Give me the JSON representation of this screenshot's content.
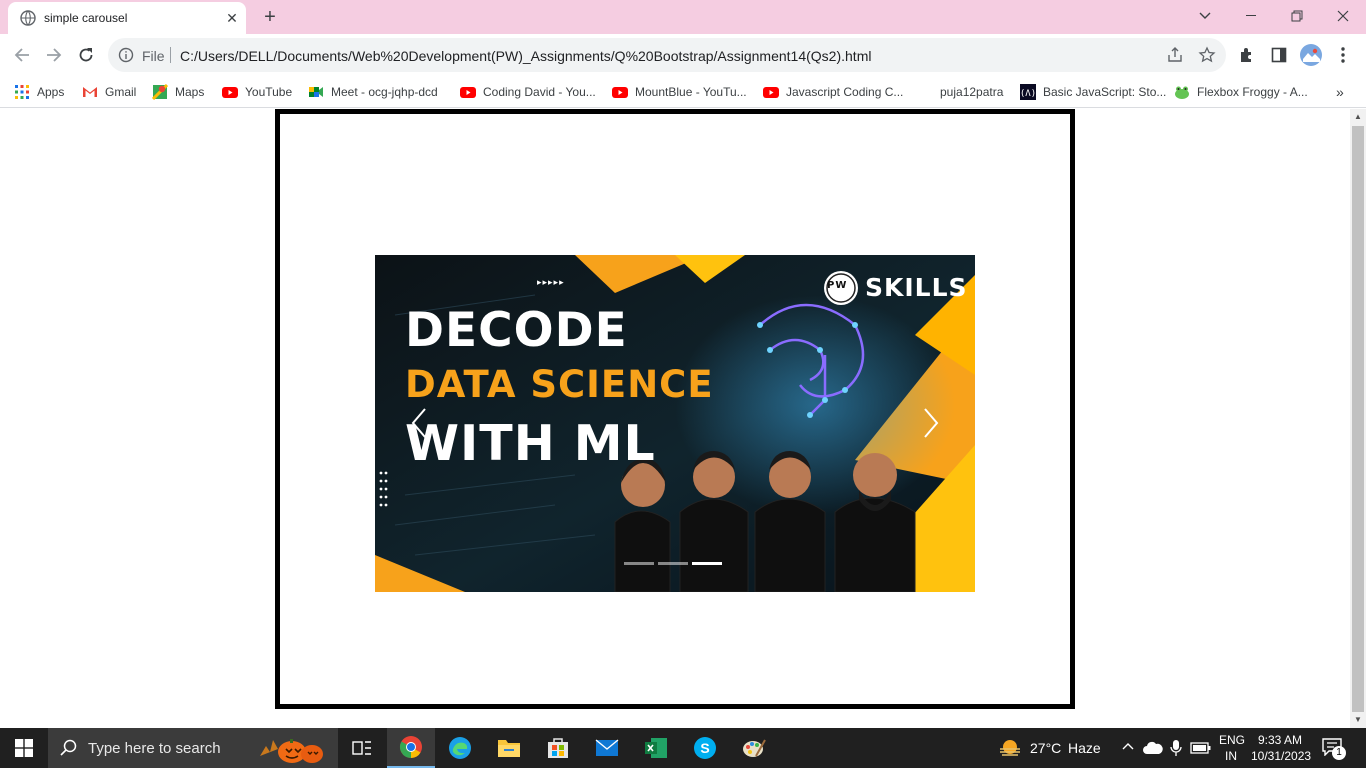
{
  "browser": {
    "tab_title": "simple carousel",
    "tab_close": "✕",
    "new_tab": "+",
    "omnibox": {
      "scheme_label": "File",
      "url": "C:/Users/DELL/Documents/Web%20Development(PW)_Assignments/Q%20Bootstrap/Assignment14(Qs2).html"
    },
    "bookmarks": [
      {
        "label": "Apps",
        "icon": "apps-grid-icon"
      },
      {
        "label": "Gmail",
        "icon": "gmail-icon"
      },
      {
        "label": "Maps",
        "icon": "maps-icon"
      },
      {
        "label": "YouTube",
        "icon": "youtube-icon"
      },
      {
        "label": "Meet - ocg-jqhp-dcd",
        "icon": "meet-icon"
      },
      {
        "label": "Coding David - You...",
        "icon": "youtube-icon"
      },
      {
        "label": "MountBlue - YouTu...",
        "icon": "youtube-icon"
      },
      {
        "label": "Javascript Coding C...",
        "icon": "youtube-icon"
      },
      {
        "label": "puja12patra",
        "icon": "none"
      },
      {
        "label": "Basic JavaScript: Sto...",
        "icon": "freecodecamp-icon"
      },
      {
        "label": "Flexbox Froggy - A...",
        "icon": "frog-icon"
      }
    ],
    "bookmarks_more": "»"
  },
  "carousel": {
    "slide": {
      "line1": "DECODE",
      "line2": "DATA SCIENCE",
      "line3": "WITH ML",
      "brand": "SKILLS",
      "brand_badge": "PW",
      "arrows_marker": "▸▸▸▸▸"
    },
    "indicators": [
      {
        "active": false
      },
      {
        "active": false
      },
      {
        "active": true
      }
    ],
    "colors": {
      "accent_orange": "#f7a21b",
      "accent_yellow": "#ffc20e"
    }
  },
  "taskbar": {
    "search_placeholder": "Type here to search",
    "weather_temp": "27°C",
    "weather_text": "Haze",
    "lang_top": "ENG",
    "lang_bottom": "IN",
    "time": "9:33 AM",
    "date": "10/31/2023",
    "notification_count": "1"
  }
}
